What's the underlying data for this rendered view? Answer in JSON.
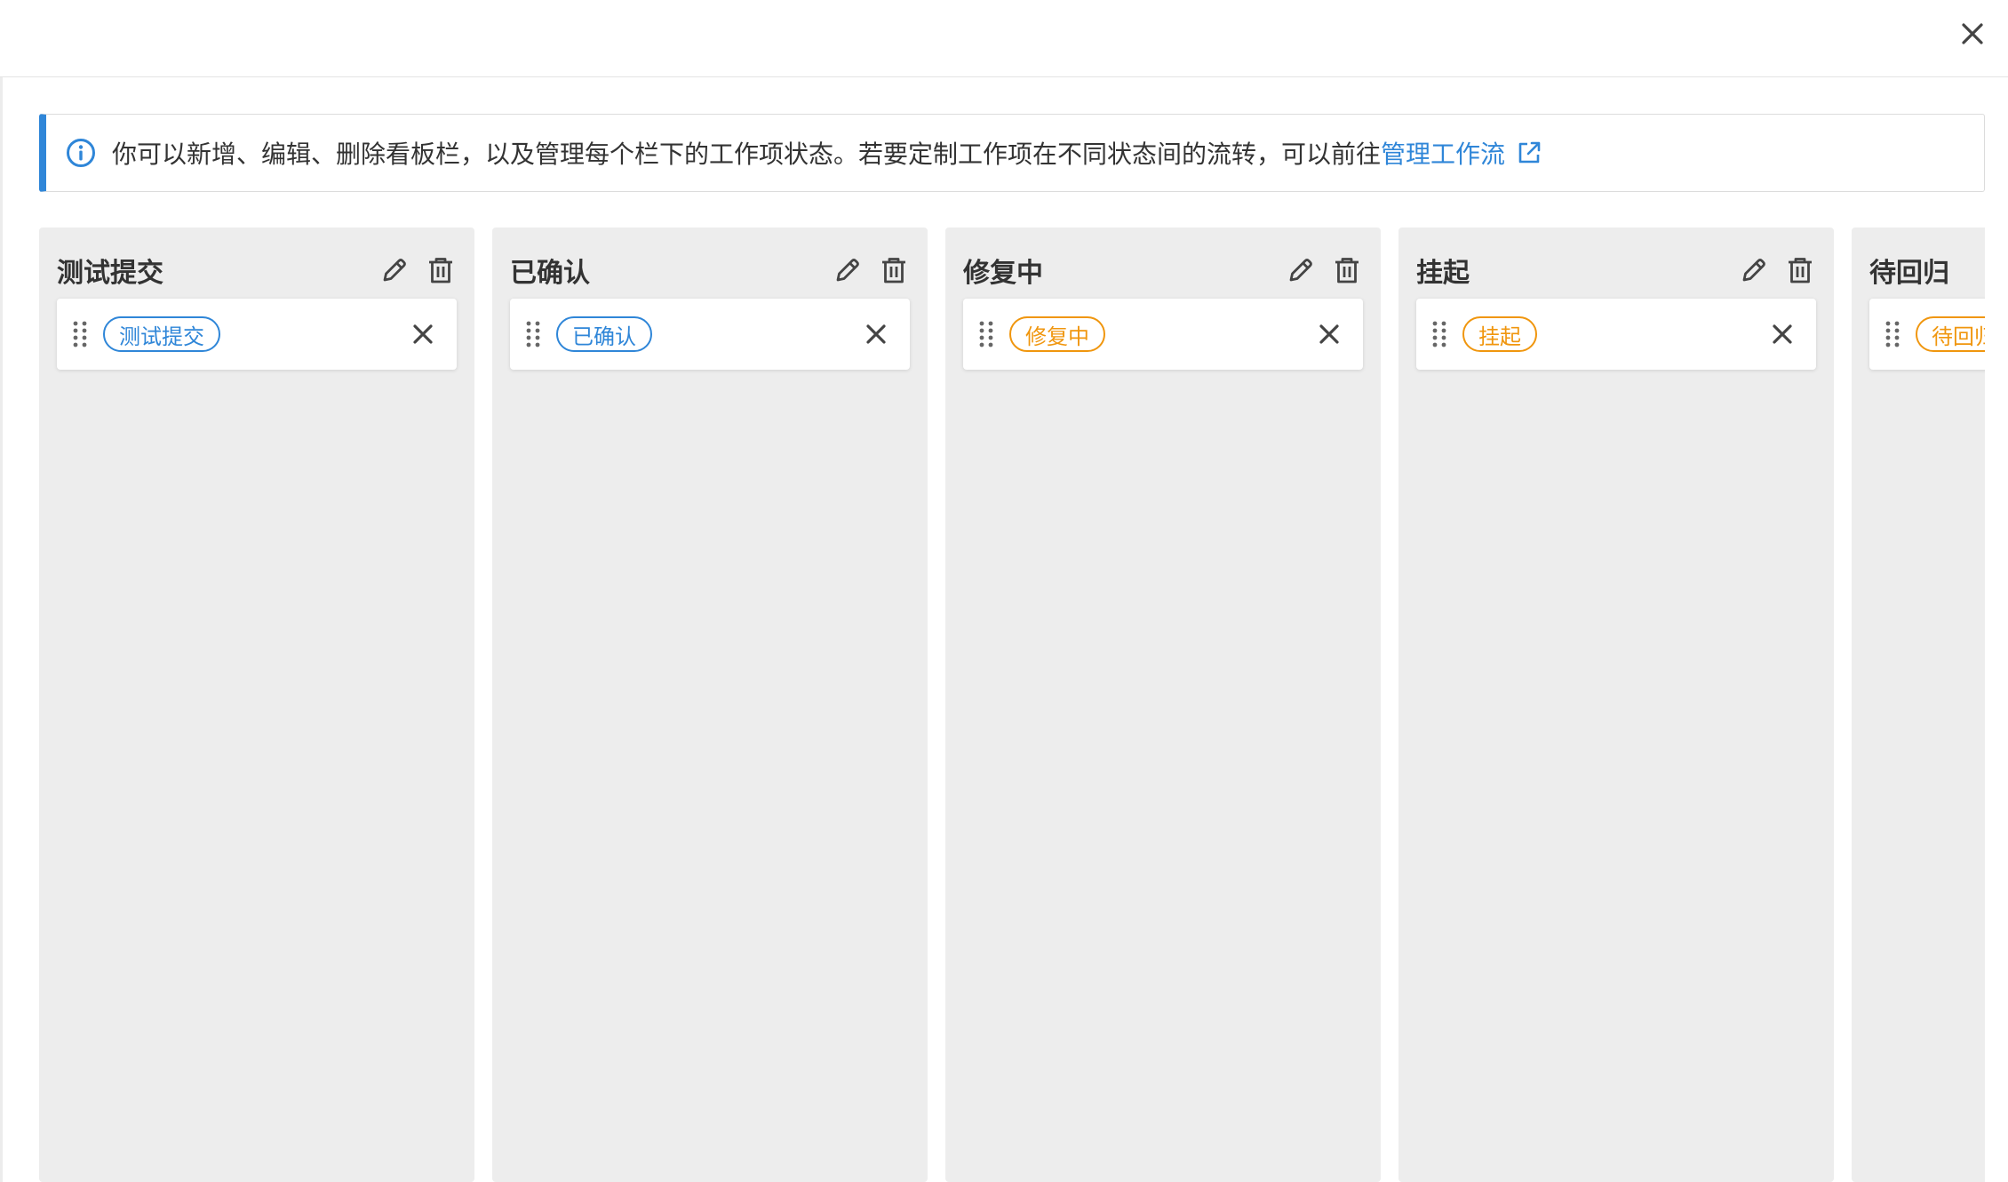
{
  "notice": {
    "text": "你可以新增、编辑、删除看板栏，以及管理每个栏下的工作项状态。若要定制工作项在不同状态间的流转，可以前往",
    "link_label": "管理工作流"
  },
  "colors": {
    "accent": "#2f86d8",
    "orange": "#f0960e",
    "column_bg": "#ededed"
  },
  "icons": {
    "close": "close-icon",
    "info": "info-icon",
    "external": "external-link-icon",
    "edit": "pencil-icon",
    "delete": "trash-icon",
    "drag": "drag-handle-icon",
    "remove": "close-icon"
  },
  "columns": [
    {
      "title": "测试提交",
      "status": {
        "label": "测试提交",
        "color": "blue"
      }
    },
    {
      "title": "已确认",
      "status": {
        "label": "已确认",
        "color": "blue"
      }
    },
    {
      "title": "修复中",
      "status": {
        "label": "修复中",
        "color": "orange"
      }
    },
    {
      "title": "挂起",
      "status": {
        "label": "挂起",
        "color": "orange"
      }
    },
    {
      "title": "待回归",
      "status": {
        "label": "待回归",
        "color": "orange"
      }
    }
  ]
}
